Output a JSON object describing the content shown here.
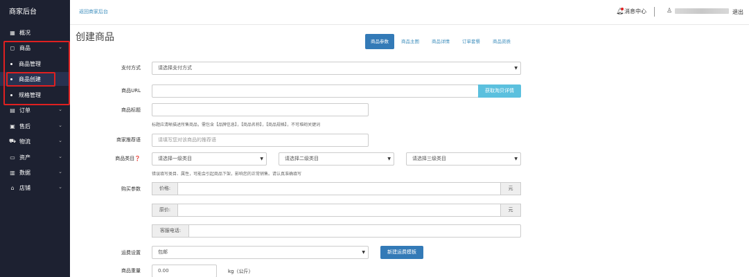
{
  "sidebar": {
    "brand": "商家后台",
    "items": [
      {
        "label": "概况",
        "icon": "grid-icon"
      },
      {
        "label": "商品",
        "icon": "bag-icon"
      },
      {
        "label": "订单",
        "icon": "order-icon"
      },
      {
        "label": "售后",
        "icon": "aftersale-icon"
      },
      {
        "label": "物流",
        "icon": "truck-icon"
      },
      {
        "label": "资产",
        "icon": "wallet-icon"
      },
      {
        "label": "数据",
        "icon": "bar-chart-icon"
      },
      {
        "label": "店铺",
        "icon": "shop-icon"
      }
    ],
    "sub_items": [
      {
        "label": "商品管理"
      },
      {
        "label": "商品创建"
      },
      {
        "label": "规格管理"
      }
    ]
  },
  "topbar": {
    "back_link": "返回商家后台",
    "messages": "消息中心",
    "logout": "退出"
  },
  "main": {
    "title": "创建商品",
    "tabs": [
      "商品参数",
      "商品主图",
      "商品详情",
      "订单套餐",
      "商品资质"
    ],
    "form": {
      "payment": {
        "label": "支付方式",
        "value": "请选择支付方式"
      },
      "url": {
        "label": "商品URL",
        "button": "获取淘贝详情"
      },
      "title": {
        "label": "商品标题",
        "help": "标题应清晰描述所售商品，需包含【品牌信息】，【商品名称】，【商品规格】，不可堆砌关键词"
      },
      "recommend": {
        "label": "商家推荐语",
        "placeholder": "请填写您对该商品的推荐语"
      },
      "category": {
        "label": "商品类目❓",
        "level1": "请选择一级类目",
        "level2": "请选择二级类目",
        "level3": "请选择三级类目",
        "help": "错误填写类目、属性，可能会引起商品下架，影响您的正常销售。请认真准确填写"
      },
      "purchase": {
        "label": "购买参数",
        "price_label": "价格:",
        "orig_price_label": "原价:",
        "phone_label": "客服电话:",
        "currency": "元"
      },
      "shipping": {
        "label": "运费设置",
        "value": "包邮",
        "button": "新建运费模板"
      },
      "weight": {
        "label": "商品重量",
        "value": "0.00",
        "unit": "kg（公斤）"
      }
    }
  },
  "colors": {
    "sidebar_bg": "#1d2131",
    "active_bg": "#283250",
    "highlight_border": "#e02020",
    "primary": "#337ab7",
    "info": "#5bc0de"
  }
}
